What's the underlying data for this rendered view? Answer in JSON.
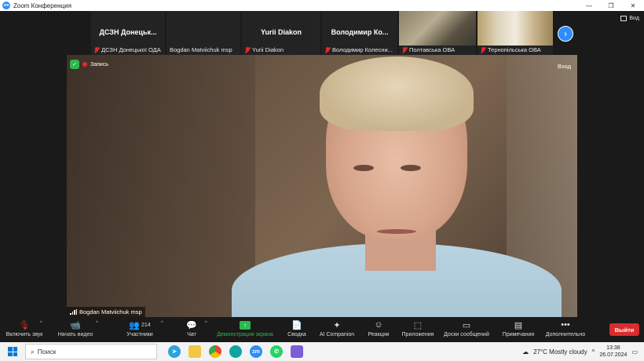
{
  "window": {
    "title": "Zoom Конференция",
    "controls": [
      "—",
      "❐",
      "✕"
    ]
  },
  "gallery": {
    "tiles": [
      {
        "big": "ДСЗН Донецьк...",
        "small": "ДСЗН Донецької ОДА",
        "muted": true
      },
      {
        "big": "",
        "small": "Bogdan Matviichuk msp",
        "muted": false
      },
      {
        "big": "Yurii Diakon",
        "small": "Yurii Diakon",
        "muted": true
      },
      {
        "big": "Володимир Ко...",
        "small": "Володимир Колесни...",
        "muted": true
      },
      {
        "big": "",
        "small": "Полтавська ОВА",
        "muted": true
      },
      {
        "big": "",
        "small": "Тернопільська ОВА",
        "muted": true
      }
    ],
    "next_icon": "chevron-right-icon",
    "view_label": "Вид"
  },
  "stage": {
    "recording_label": "Запись",
    "enter_label": "Вход",
    "speaker_name": "Bogdan Matviichuk msp"
  },
  "toolbar": {
    "items": [
      {
        "label": "Включить звук",
        "icon": "mic-muted-icon"
      },
      {
        "label": "Начать видео",
        "icon": "video-off-icon"
      },
      {
        "label": "Участники",
        "icon": "participants-icon",
        "count": "214"
      },
      {
        "label": "Чат",
        "icon": "chat-icon"
      },
      {
        "label": "Демонстрация экрана",
        "icon": "share-screen-icon"
      },
      {
        "label": "Сводка",
        "icon": "summary-icon"
      },
      {
        "label": "AI Companion",
        "icon": "ai-companion-icon"
      },
      {
        "label": "Реакции",
        "icon": "reactions-icon"
      },
      {
        "label": "Приложения",
        "icon": "apps-icon"
      },
      {
        "label": "Доски сообщений",
        "icon": "whiteboard-icon"
      },
      {
        "label": "Примечания",
        "icon": "notes-icon"
      },
      {
        "label": "Дополнительно",
        "icon": "more-icon"
      }
    ],
    "leave_label": "Выйти"
  },
  "taskbar": {
    "search_placeholder": "Поиск",
    "weather": "27°C  Mostly cloudy",
    "time": "13:38",
    "date": "26.07.2024"
  },
  "colors": {
    "accent": "#2d8cff",
    "share_green": "#2db84d",
    "leave_red": "#d92c2c",
    "muted_red": "#e02b2b"
  }
}
